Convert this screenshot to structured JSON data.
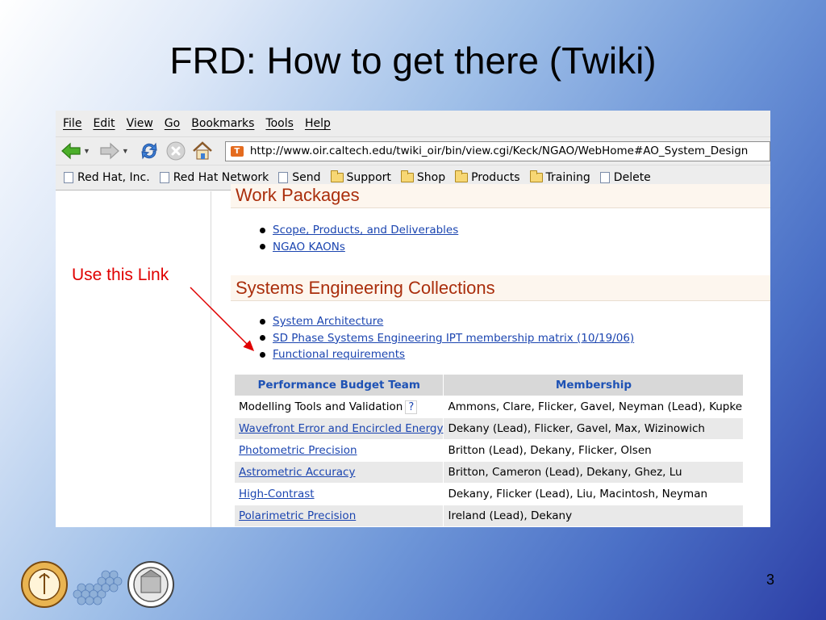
{
  "slide": {
    "title": "FRD: How to get there (Twiki)",
    "annotation": "Use this Link",
    "page_number": "3"
  },
  "browser": {
    "menu": [
      "File",
      "Edit",
      "View",
      "Go",
      "Bookmarks",
      "Tools",
      "Help"
    ],
    "url": "http://www.oir.caltech.edu/twiki_oir/bin/view.cgi/Keck/NGAO/WebHome#AO_System_Design",
    "bookmarks": [
      {
        "label": "Red Hat, Inc.",
        "icon": "page-icon"
      },
      {
        "label": "Red Hat Network",
        "icon": "page-icon"
      },
      {
        "label": "Send",
        "icon": "page-icon"
      },
      {
        "label": "Support",
        "icon": "folder-icon"
      },
      {
        "label": "Shop",
        "icon": "folder-icon"
      },
      {
        "label": "Products",
        "icon": "folder-icon"
      },
      {
        "label": "Training",
        "icon": "folder-icon"
      },
      {
        "label": "Delete",
        "icon": "page-icon"
      }
    ]
  },
  "page": {
    "work_packages_heading": "Work Packages",
    "work_packages_links": [
      "Scope, Products, and Deliverables",
      "NGAO KAONs"
    ],
    "systems_heading": "Systems Engineering Collections",
    "systems_links": [
      "System Architecture",
      "SD Phase Systems Engineering IPT membership matrix (10/19/06)",
      "Functional requirements"
    ],
    "table": {
      "headers": [
        "Performance Budget Team",
        "Membership"
      ],
      "rows": [
        {
          "team": "Modelling Tools and Validation",
          "link": false,
          "qmark": "?",
          "members": "Ammons, Clare, Flicker, Gavel, Neyman (Lead), Kupke"
        },
        {
          "team": "Wavefront Error and Encircled Energy",
          "link": true,
          "members": "Dekany (Lead), Flicker, Gavel, Max, Wizinowich"
        },
        {
          "team": "Photometric Precision",
          "link": true,
          "members": "Britton (Lead), Dekany, Flicker, Olsen"
        },
        {
          "team": "Astrometric Accuracy",
          "link": true,
          "members": "Britton, Cameron (Lead), Dekany, Ghez, Lu"
        },
        {
          "team": "High-Contrast",
          "link": true,
          "members": "Dekany, Flicker (Lead), Liu, Macintosh, Neyman"
        },
        {
          "team": "Polarimetric Precision",
          "link": true,
          "members": "Ireland (Lead), Dekany"
        }
      ]
    }
  },
  "colors": {
    "heading_red": "#aa2e0c",
    "link_blue": "#1b45b0",
    "annotation_red": "#e00000"
  }
}
